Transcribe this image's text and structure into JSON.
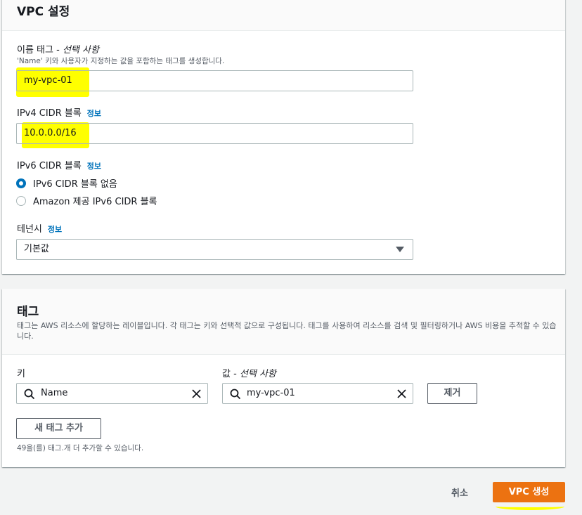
{
  "vpc_settings": {
    "title": "VPC 설정",
    "name_tag": {
      "label": "이름 태그 - ",
      "label_optional": "선택 사항",
      "hint": "'Name' 키와 사용자가 지정하는 값을 포함하는 태그를 생성합니다.",
      "value": "my-vpc-01"
    },
    "ipv4_cidr": {
      "label": "IPv4 CIDR 블록",
      "info": "정보",
      "value": "10.0.0.0/16"
    },
    "ipv6_cidr": {
      "label": "IPv6 CIDR 블록",
      "info": "정보",
      "options": [
        {
          "label": "IPv6 CIDR 블록 없음",
          "selected": true
        },
        {
          "label": "Amazon 제공 IPv6 CIDR 블록",
          "selected": false
        }
      ]
    },
    "tenancy": {
      "label": "테넌시",
      "info": "정보",
      "value": "기본값"
    }
  },
  "tags": {
    "title": "태그",
    "description": "태그는 AWS 리소스에 할당하는 레이블입니다. 각 태그는 키와 선택적 값으로 구성됩니다. 태그를 사용하여 리소스를 검색 및 필터링하거나 AWS 비용을 추적할 수 있습니다.",
    "key_label": "키",
    "value_label": "값 - ",
    "value_label_optional": "선택 사항",
    "rows": [
      {
        "key": "Name",
        "value": "my-vpc-01",
        "remove_label": "제거"
      }
    ],
    "add_label": "새 태그 추가",
    "limit_hint": "49을(를) 태그.개 더 추가할 수 있습니다."
  },
  "footer": {
    "cancel_label": "취소",
    "create_label": "VPC 생성"
  },
  "colors": {
    "highlight": "#ffff00",
    "primary": "#ec7211",
    "link": "#0073bb"
  }
}
